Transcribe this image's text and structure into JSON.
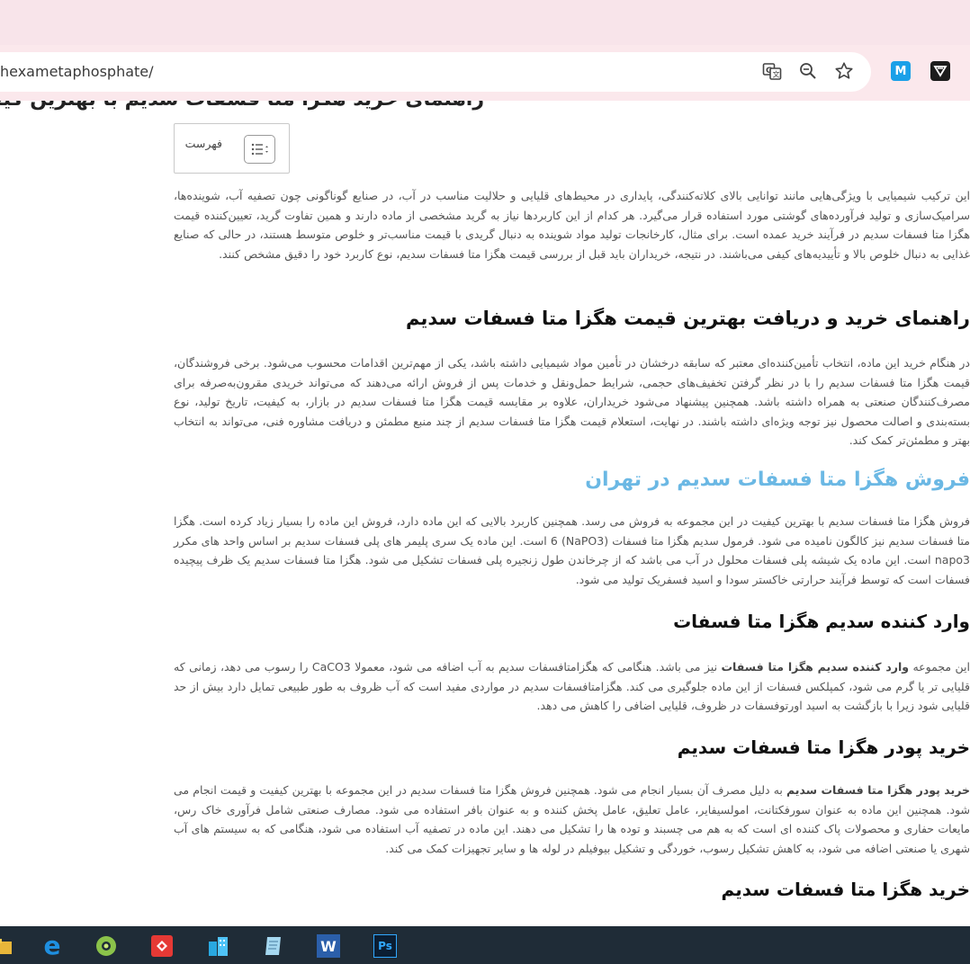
{
  "browser": {
    "url": "hexametaphosphate/",
    "icons": [
      "translate-icon",
      "zoom-icon",
      "bookmark-star-icon"
    ],
    "extensions": [
      {
        "name": "m-extension-icon",
        "glyph": "M",
        "color": "#1aa0e8"
      },
      {
        "name": "shield-extension-icon",
        "glyph": "V",
        "color": "#1c1c1c"
      }
    ]
  },
  "article": {
    "partial_heading": "راهنمای خرید هگزا متا فسفات سدیم با بهترین کیفیت",
    "toc_label": "فهرست",
    "intro": "این ترکیب شیمیایی با ویژگی‌هایی مانند توانایی بالای کلاته‌کنندگی، پایداری در محیط‌های قلیایی و حلالیت مناسب در آب، در صنایع گوناگونی چون تصفیه آب، شوینده‌ها، سرامیک‌سازی و تولید فرآورده‌های گوشتی مورد استفاده قرار می‌گیرد. هر کدام از این کاربردها نیاز به گرید مشخصی از ماده دارند و همین تفاوت گرید، تعیین‌کننده قیمت هگزا متا فسفات سدیم در فرآیند خرید عمده است. برای مثال، کارخانجات تولید مواد شوینده به دنبال گریدی با قیمت مناسب‌تر و خلوص متوسط هستند، در حالی که صنایع غذایی به دنبال خلوص بالا و تأییدیه‌های کیفی می‌باشند. در نتیجه، خریداران باید قبل از بررسی قیمت هگزا متا فسفات سدیم، نوع کاربرد خود را دقیق مشخص کنند.",
    "h_guide": "راهنمای خرید و دریافت بهترین قیمت هگزا متا فسفات سدیم",
    "p_guide": "در هنگام خرید این ماده، انتخاب تأمین‌کننده‌ای معتبر که سابقه درخشان در تأمین مواد شیمیایی داشته باشد، یکی از مهم‌ترین اقدامات محسوب می‌شود. برخی فروشندگان، قیمت هگزا متا فسفات سدیم را با در نظر گرفتن تخفیف‌های حجمی، شرایط حمل‌ونقل و خدمات پس از فروش ارائه می‌دهند که می‌تواند خریدی مقرون‌به‌صرفه برای مصرف‌کنندگان صنعتی به همراه داشته باشد. همچنین پیشنهاد می‌شود خریداران، علاوه بر مقایسه قیمت هگزا متا فسفات سدیم در بازار، به کیفیت، تاریخ تولید، نوع بسته‌بندی و اصالت محصول نیز توجه ویژه‌ای داشته باشند. در نهایت، استعلام قیمت هگزا متا فسفات سدیم از چند منبع مطمئن و دریافت مشاوره فنی، می‌تواند به انتخاب بهتر و مطمئن‌تر کمک کند.",
    "h_tehran": "فروش هگزا متا فسفات سدیم در تهران",
    "p_tehran": "فروش هگزا متا فسفات سدیم با بهترین کیفیت در این مجموعه به فروش می رسد. همچنین کاربرد بالایی که این ماده دارد، فروش این ماده را بسیار زیاد کرده است. هگزا متا فسفات سدیم نیز کالگون نامیده می شود. فرمول سدیم هگزا متا فسفات (NaPO3) 6 است. این ماده یک سری پلیمر های پلی فسفات سدیم بر اساس واحد های مکرر napo3 است. این ماده یک شیشه پلی فسفات محلول در آب می باشد که از چرخاندن طول زنجیره پلی فسفات تشکیل می شود. هگزا متا فسفات سدیم یک ظرف پیچیده فسفات است که توسط فرآیند حرارتی خاکستر سودا و اسید فسفریک تولید می شود.",
    "h_importer": "وارد کننده سدیم هگزا متا فسفات",
    "p_importer_pre": "این مجموعه ",
    "p_importer_bold": "وارد کننده سدیم هگزا متا فسفات",
    "p_importer_post": " نیز می باشد. هنگامی که هگزامتافسفات سدیم به آب اضافه می شود، معمولا CaCO3 را رسوب می دهد، زمانی که قلیایی تر یا گرم می شود، کمپلکس فسفات از این ماده جلوگیری می کند. هگزامتافسفات سدیم در مواردی مفید است که آب ظروف به طور طبیعی تمایل دارد بیش از حد قلیایی شود زیرا با بازگشت به اسید اورتوفسفات در ظروف، قلیایی اضافی را کاهش می دهد.",
    "h_powder": "خرید پودر هگزا متا فسفات سدیم",
    "p_powder_bold": "خرید پودر هگزا متا فسفات سدیم",
    "p_powder_post": " به دلیل مصرف آن بسیار انجام می شود. همچنین فروش هگزا متا فسفات سدیم در این مجموعه با بهترین کیفیت و قیمت انجام می شود. همچنین این ماده به عنوان سورفکتانت، امولسیفایر، عامل تعلیق، عامل پخش کننده و به عنوان بافر استفاده می شود. مصارف صنعتی شامل فرآوری خاک رس، مایعات حفاری و محصولات پاک کننده ای است که به هم می چسبند و توده ها را تشکیل می دهند. این ماده در تصفیه آب استفاده می شود، هنگامی که به سیستم های آب شهری یا صنعتی اضافه می شود، به کاهش تشکیل رسوب، خوردگی و تشکیل بیوفیلم در لوله ها و سایر تجهیزات کمک می کند.",
    "h_buy": "خرید هگزا متا فسفات سدیم"
  },
  "colors": {
    "accent_heading": "#6bb8e4",
    "taskbar": "#1f2c37"
  },
  "taskbar": [
    {
      "name": "taskbar-folder-icon"
    },
    {
      "name": "taskbar-edge-icon",
      "glyph": "e"
    },
    {
      "name": "taskbar-app-green-icon"
    },
    {
      "name": "taskbar-anydesk-icon"
    },
    {
      "name": "taskbar-buildings-icon"
    },
    {
      "name": "taskbar-notepad-icon"
    },
    {
      "name": "taskbar-word-icon",
      "glyph": "W"
    },
    {
      "name": "taskbar-photoshop-icon",
      "glyph": "Ps"
    }
  ]
}
